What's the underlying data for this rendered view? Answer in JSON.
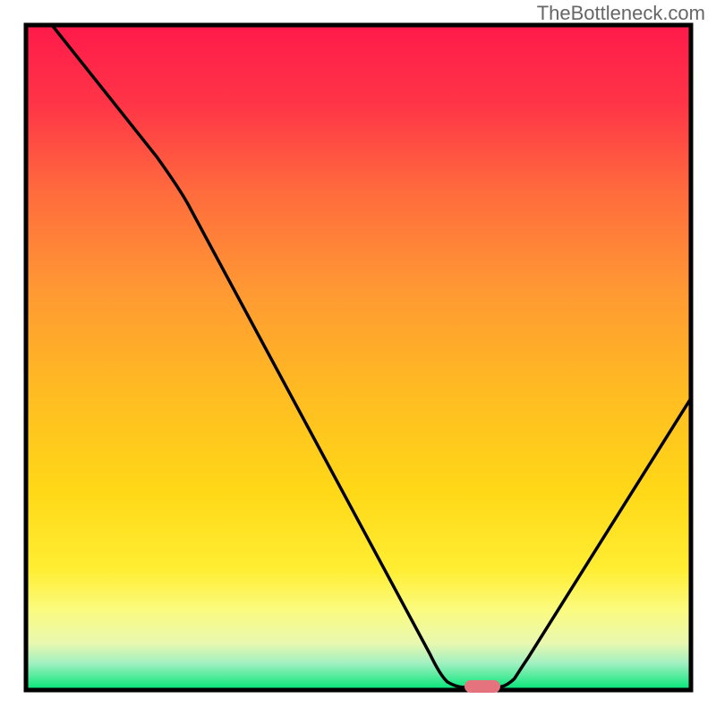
{
  "watermark": "TheBottleneck.com",
  "chart_data": {
    "type": "line",
    "title": "",
    "xlabel": "",
    "ylabel": "",
    "xlim": [
      0,
      100
    ],
    "ylim": [
      0,
      100
    ],
    "curve_points": [
      {
        "x": 4,
        "y": 100
      },
      {
        "x": 20,
        "y": 80
      },
      {
        "x": 24,
        "y": 74
      },
      {
        "x": 61,
        "y": 5
      },
      {
        "x": 62,
        "y": 2
      },
      {
        "x": 64,
        "y": 0.5
      },
      {
        "x": 70,
        "y": 0.5
      },
      {
        "x": 72,
        "y": 2
      },
      {
        "x": 100,
        "y": 44
      }
    ],
    "marker": {
      "x": 68,
      "y": 0.5,
      "color": "#e57588"
    },
    "gradient_stops": [
      {
        "offset": 0,
        "color": "#ff1744"
      },
      {
        "offset": 50,
        "color": "#ffc107"
      },
      {
        "offset": 82,
        "color": "#ffeb3b"
      },
      {
        "offset": 90,
        "color": "#fdfd96"
      },
      {
        "offset": 96,
        "color": "#b9f6ca"
      },
      {
        "offset": 100,
        "color": "#00e676"
      }
    ],
    "border_color": "#000000",
    "border_width": 4
  }
}
